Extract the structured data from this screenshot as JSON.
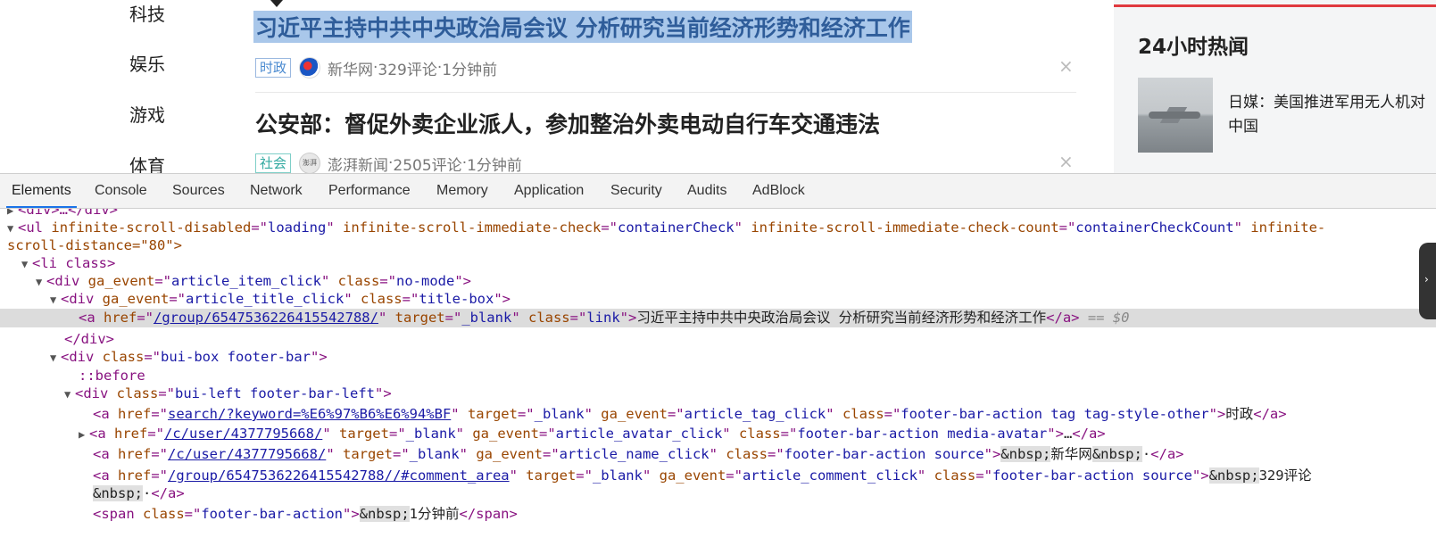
{
  "page": {
    "nav": [
      "科技",
      "娱乐",
      "游戏",
      "体育"
    ],
    "articles": [
      {
        "title": "习近平主持中共中央政治局会议 分析研究当前经济形势和经济工作",
        "tag": "时政",
        "source": "新华网",
        "comments": "329评论",
        "time": "1分钟前",
        "close": "×"
      },
      {
        "title": "公安部：督促外卖企业派人，参加整治外卖电动自行车交通违法",
        "tag": "社会",
        "source": "澎湃新闻",
        "comments": "2505评论",
        "time": "1分钟前",
        "close": "×",
        "avatar_text": "澎湃"
      }
    ],
    "meta_sep": " · ",
    "hot": {
      "title": "24小时热闻",
      "item_text": "日媒：美国推进军用无人机对中国"
    }
  },
  "devtools": {
    "tabs": [
      "Elements",
      "Console",
      "Sources",
      "Network",
      "Performance",
      "Memory",
      "Application",
      "Security",
      "Audits",
      "AdBlock"
    ],
    "active_tab": "Elements",
    "selection_marker": "== $0",
    "lines": {
      "l0": {
        "text": "<div>…</div>"
      },
      "l1": {
        "tag": "ul",
        "attrs": [
          [
            "infinite-scroll-disabled",
            "loading"
          ],
          [
            "infinite-scroll-immediate-check",
            "containerCheck"
          ],
          [
            "infinite-scroll-immediate-check-count",
            "containerCheckCount"
          ]
        ],
        "overflow": "infinite-"
      },
      "l1b": {
        "text": "scroll-distance=\"80\">"
      },
      "l2": {
        "text": "<li class>"
      },
      "l3": {
        "attrs": [
          [
            "ga_event",
            "article_item_click"
          ],
          [
            "class",
            "no-mode"
          ]
        ]
      },
      "l4": {
        "attrs": [
          [
            "ga_event",
            "article_title_click"
          ],
          [
            "class",
            "title-box"
          ]
        ]
      },
      "l5": {
        "href": "/group/6547536226415542788/",
        "target": "_blank",
        "class": "link",
        "text": "习近平主持中共中央政治局会议 分析研究当前经济形势和经济工作"
      },
      "l6": {
        "text": "</div>"
      },
      "l7": {
        "class": "bui-box footer-bar"
      },
      "l8": {
        "text": "::before"
      },
      "l9": {
        "class": "bui-left footer-bar-left"
      },
      "l10": {
        "href": "search/?keyword=%E6%97%B6%E6%94%BF",
        "target": "_blank",
        "ga_event": "article_tag_click",
        "class": "footer-bar-action tag tag-style-other",
        "text": "时政"
      },
      "l11": {
        "href": "/c/user/4377795668/",
        "target": "_blank",
        "ga_event": "article_avatar_click",
        "class": "footer-bar-action media-avatar",
        "text": "…"
      },
      "l12": {
        "href": "/c/user/4377795668/",
        "target": "_blank",
        "ga_event": "article_name_click",
        "class": "footer-bar-action source",
        "nbsp": "&nbsp;",
        "text": "新华网",
        "tail": "·"
      },
      "l13": {
        "href": "/group/6547536226415542788//#comment_area",
        "target": "_blank",
        "ga_event": "article_comment_click",
        "class": "footer-bar-action source",
        "nbsp": "&nbsp;",
        "text": "329评论"
      },
      "l13b": {
        "nbsp": "&nbsp;",
        "tail": "·"
      },
      "l14": {
        "class": "footer-bar-action",
        "nbsp": "&nbsp;",
        "text": "1分钟前"
      }
    }
  }
}
